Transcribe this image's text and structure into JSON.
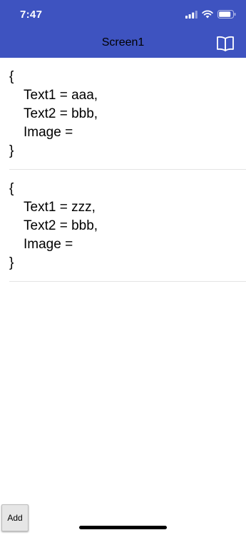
{
  "status_bar": {
    "time": "7:47",
    "icons": [
      "cellular-signal-icon",
      "wifi-icon",
      "battery-icon"
    ]
  },
  "header": {
    "title": "Screen1",
    "action_icon": "book-icon",
    "background": "#3e53c0"
  },
  "list": {
    "items": [
      {
        "open": "{",
        "lines": [
          "Text1 = aaa,",
          "Text2 = bbb,",
          "Image ="
        ],
        "close": "}"
      },
      {
        "open": "{",
        "lines": [
          "Text1 = zzz,",
          "Text2 = bbb,",
          "Image ="
        ],
        "close": "}"
      }
    ]
  },
  "footer": {
    "add_label": "Add"
  }
}
